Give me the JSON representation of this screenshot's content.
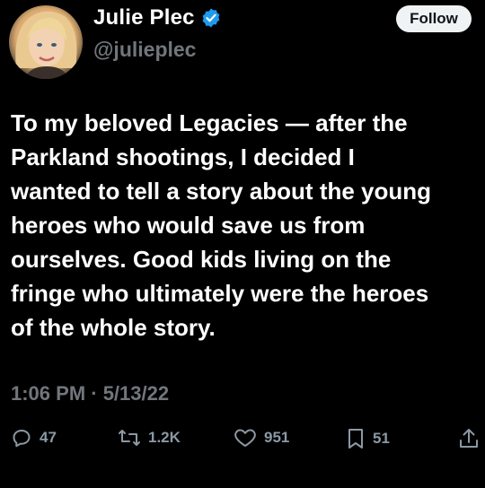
{
  "author": {
    "display_name": "Julie Plec",
    "handle": "@julieplec",
    "verified": true
  },
  "follow_label": "Follow",
  "tweet": {
    "text": "To my beloved Legacies — after the\nParkland shootings, I decided I\nwanted to tell a story about the young\nheroes who would save us from\nourselves. Good kids living on the\nfringe who ultimately were the heroes\nof the whole story."
  },
  "timestamp": "1:06 PM · 5/13/22",
  "actions": {
    "reply_count": "47",
    "retweet_count": "1.2K",
    "like_count": "951",
    "bookmark_count": "51"
  },
  "colors": {
    "background": "#000000",
    "text": "#ffffff",
    "muted": "#71767b",
    "verified": "#1d9bf0",
    "follow_bg": "#eff3f4"
  }
}
